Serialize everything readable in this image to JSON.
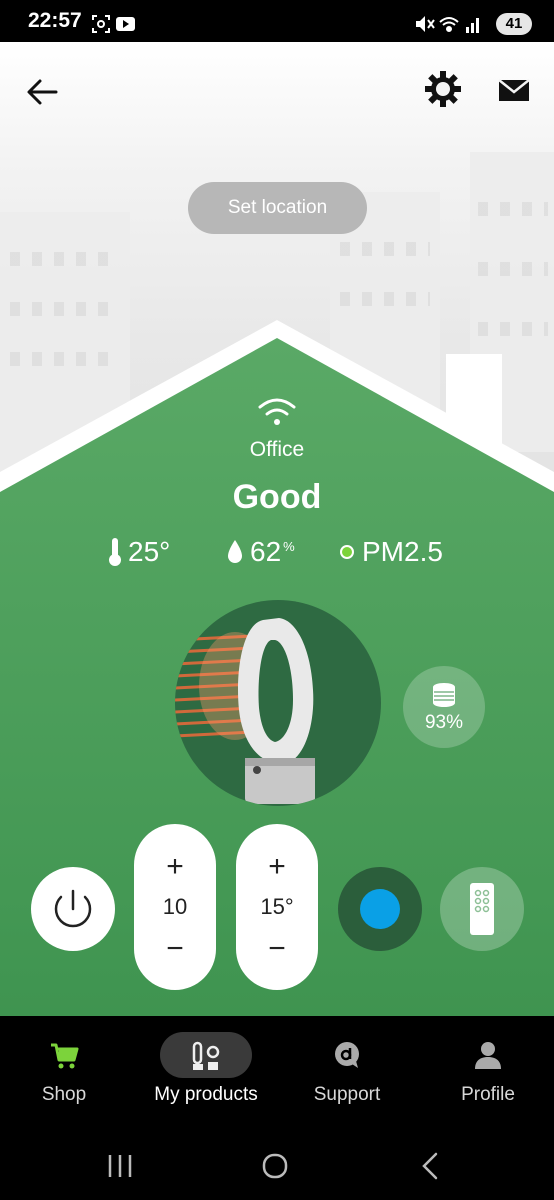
{
  "status_bar": {
    "time": "22:57",
    "battery": "41",
    "icons": [
      "screenshot-icon",
      "youtube-icon",
      "mute-icon",
      "wifi-icon",
      "signal-icon"
    ]
  },
  "header": {
    "back_icon": "arrow-left-icon",
    "settings_icon": "gear-icon",
    "mail_icon": "envelope-icon"
  },
  "location": {
    "button_label": "Set location"
  },
  "device": {
    "room": "Office",
    "air_quality": "Good",
    "temperature": "25°",
    "humidity": "62",
    "humidity_unit": "%",
    "pollutant": "PM2.5",
    "filter_life": "93%"
  },
  "controls": {
    "fan_speed_plus": "+",
    "fan_speed": "10",
    "fan_speed_minus": "−",
    "heat_plus": "+",
    "heat_target": "15°",
    "heat_minus": "−"
  },
  "bottom_nav": {
    "items": [
      {
        "label": "Shop",
        "icon": "cart-icon"
      },
      {
        "label": "My products",
        "icon": "products-icon"
      },
      {
        "label": "Support",
        "icon": "support-icon"
      },
      {
        "label": "Profile",
        "icon": "person-icon"
      }
    ],
    "active": "My products"
  },
  "colors": {
    "house_green": "#4f9f5c",
    "accent_green": "#7cd33b",
    "mode_blue": "#0aa0e6"
  }
}
